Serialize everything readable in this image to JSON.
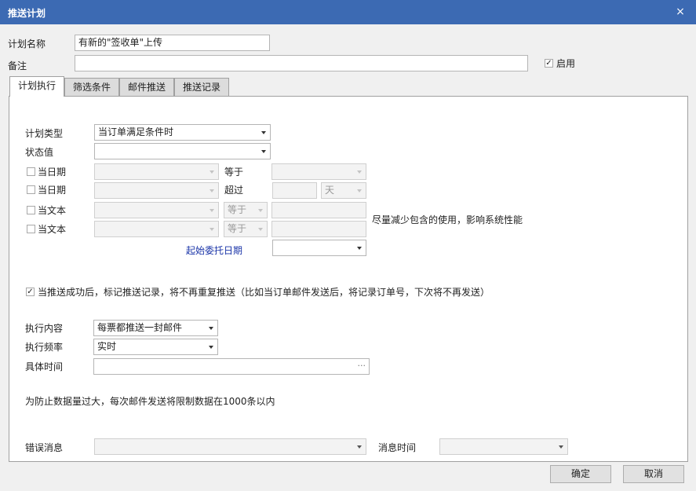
{
  "window": {
    "title": "推送计划",
    "close_icon": "×"
  },
  "header": {
    "plan_name_label": "计划名称",
    "plan_name_value": "有新的\"签收单\"上传",
    "remark_label": "备注",
    "remark_value": "",
    "enable_label": "启用",
    "enable_checked": true
  },
  "tabs": [
    {
      "label": "计划执行",
      "active": true
    },
    {
      "label": "筛选条件",
      "active": false
    },
    {
      "label": "邮件推送",
      "active": false
    },
    {
      "label": "推送记录",
      "active": false
    }
  ],
  "form": {
    "plan_type_label": "计划类型",
    "plan_type_value": "当订单满足条件时",
    "status_label": "状态值",
    "status_value": "",
    "date_row1": {
      "label": "当日期",
      "op": "等于",
      "value": ""
    },
    "date_row2": {
      "label": "当日期",
      "op": "超过",
      "amount": "",
      "unit": "天"
    },
    "text_row1": {
      "label": "当文本",
      "op": "等于",
      "value": ""
    },
    "text_row2": {
      "label": "当文本",
      "op": "等于",
      "value": ""
    },
    "perf_note": "尽量减少包含的使用，影响系统性能",
    "start_date_label": "起始委托日期",
    "start_date_value": "",
    "mark_sent_label": "当推送成功后，标记推送记录，将不再重复推送（比如当订单邮件发送后，将记录订单号，下次将不再发送）",
    "mark_sent_checked": true,
    "exec_content_label": "执行内容",
    "exec_content_value": "每票都推送一封邮件",
    "exec_freq_label": "执行频率",
    "exec_freq_value": "实时",
    "specific_time_label": "具体时间",
    "specific_time_value": "",
    "limit_note": "为防止数据量过大，每次邮件发送将限制数据在1000条以内",
    "error_msg_label": "错误消息",
    "error_msg_value": "",
    "msg_time_label": "消息时间",
    "msg_time_value": ""
  },
  "buttons": {
    "ok": "确定",
    "cancel": "取消"
  }
}
